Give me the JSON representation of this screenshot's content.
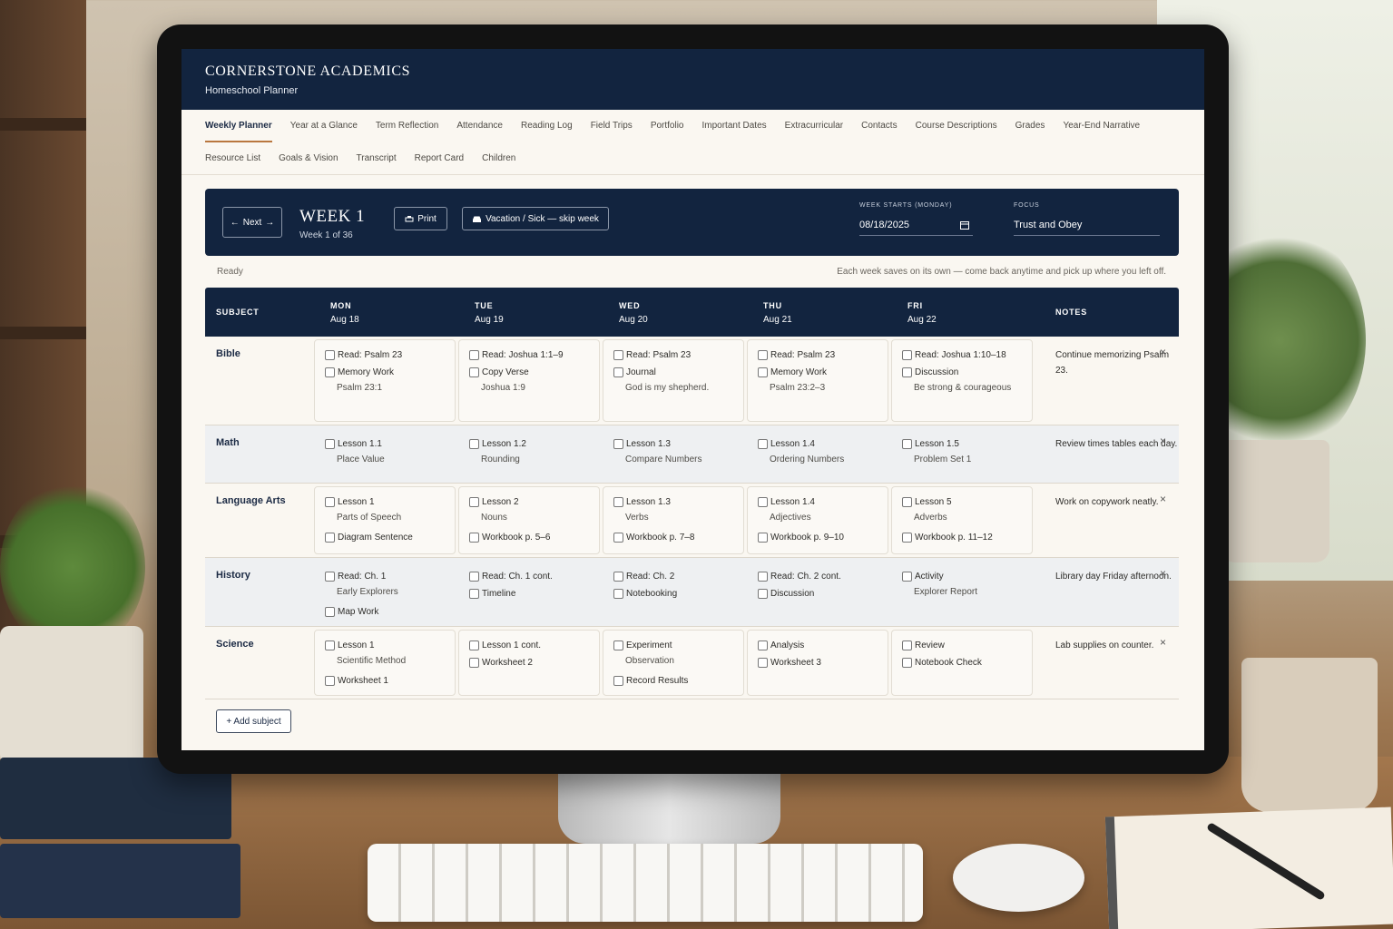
{
  "brand": {
    "title": "CORNERSTONE ACADEMICS",
    "subtitle": "Homeschool Planner"
  },
  "tabs_row1": [
    "Weekly Planner",
    "Year at a Glance",
    "Term Reflection",
    "Attendance",
    "Reading Log",
    "Field Trips",
    "Portfolio",
    "Important Dates",
    "Extracurricular",
    "Contacts",
    "Course Descriptions",
    "Grades",
    "Year-End Narrative"
  ],
  "tabs_row2": [
    "Resource List",
    "Goals & Vision",
    "Transcript",
    "Report Card",
    "Children"
  ],
  "active_tab": "Weekly Planner",
  "week": {
    "next_label": "Next",
    "title": "WEEK 1",
    "subtitle": "Week 1 of 36",
    "print_label": "Print",
    "skip_label": "Vacation / Sick — skip week",
    "start_label": "WEEK STARTS (MONDAY)",
    "start_value": "08/18/2025",
    "focus_label": "FOCUS",
    "focus_value": "Trust and Obey"
  },
  "status": {
    "left": "Ready",
    "right": "Each week saves on its own — come back anytime and pick up where you left off."
  },
  "grid": {
    "subject_header": "SUBJECT",
    "notes_header": "NOTES",
    "days": [
      {
        "day": "MON",
        "date": "Aug 18"
      },
      {
        "day": "TUE",
        "date": "Aug 19"
      },
      {
        "day": "WED",
        "date": "Aug 20"
      },
      {
        "day": "THU",
        "date": "Aug 21"
      },
      {
        "day": "FRI",
        "date": "Aug 22"
      }
    ],
    "rows": [
      {
        "subject": "Bible",
        "notes": "Continue memorizing Psalm 23.",
        "cells": [
          [
            {
              "label": "Read: Psalm 23"
            },
            {
              "label": "Memory Work",
              "sub": "Psalm 23:1"
            }
          ],
          [
            {
              "label": "Read: Joshua 1:1–9"
            },
            {
              "label": "Copy Verse",
              "sub": "Joshua 1:9"
            }
          ],
          [
            {
              "label": "Read: Psalm 23"
            },
            {
              "label": "Journal",
              "sub": "God is my shepherd."
            }
          ],
          [
            {
              "label": "Read: Psalm 23"
            },
            {
              "label": "Memory Work",
              "sub": "Psalm 23:2–3"
            }
          ],
          [
            {
              "label": "Read: Joshua 1:10–18"
            },
            {
              "label": "Discussion",
              "sub": "Be strong & courageous"
            }
          ]
        ]
      },
      {
        "subject": "Math",
        "notes": "Review times tables each day.",
        "cells": [
          [
            {
              "label": "Lesson 1.1",
              "sub": "Place Value"
            }
          ],
          [
            {
              "label": "Lesson 1.2",
              "sub": "Rounding"
            }
          ],
          [
            {
              "label": "Lesson 1.3",
              "sub": "Compare Numbers"
            }
          ],
          [
            {
              "label": "Lesson 1.4",
              "sub": "Ordering Numbers"
            }
          ],
          [
            {
              "label": "Lesson 1.5",
              "sub": "Problem Set 1"
            }
          ]
        ]
      },
      {
        "subject": "Language Arts",
        "notes": "Work on copywork neatly.",
        "cells": [
          [
            {
              "label": "Lesson 1",
              "sub": "Parts of Speech"
            },
            {
              "label": "Diagram Sentence"
            }
          ],
          [
            {
              "label": "Lesson 2",
              "sub": "Nouns"
            },
            {
              "label": "Workbook p. 5–6"
            }
          ],
          [
            {
              "label": "Lesson 1.3",
              "sub": "Verbs"
            },
            {
              "label": "Workbook p. 7–8"
            }
          ],
          [
            {
              "label": "Lesson 1.4",
              "sub": "Adjectives"
            },
            {
              "label": "Workbook p. 9–10"
            }
          ],
          [
            {
              "label": "Lesson 5",
              "sub": "Adverbs"
            },
            {
              "label": "Workbook p. 11–12"
            }
          ]
        ]
      },
      {
        "subject": "History",
        "notes": "Library day Friday afternoon.",
        "cells": [
          [
            {
              "label": "Read: Ch. 1",
              "sub": "Early Explorers"
            },
            {
              "label": "Map Work"
            }
          ],
          [
            {
              "label": "Read: Ch. 1 cont."
            },
            {
              "label": "Timeline"
            }
          ],
          [
            {
              "label": "Read: Ch. 2"
            },
            {
              "label": "Notebooking"
            }
          ],
          [
            {
              "label": "Read: Ch. 2 cont."
            },
            {
              "label": "Discussion"
            }
          ],
          [
            {
              "label": "Activity",
              "sub": "Explorer Report"
            }
          ]
        ]
      },
      {
        "subject": "Science",
        "notes": "Lab supplies on counter.",
        "cells": [
          [
            {
              "label": "Lesson 1",
              "sub": "Scientific Method"
            },
            {
              "label": "Worksheet 1"
            }
          ],
          [
            {
              "label": "Lesson 1 cont."
            },
            {
              "label": "Worksheet 2"
            }
          ],
          [
            {
              "label": "Experiment",
              "sub": "Observation"
            },
            {
              "label": "Record Results"
            }
          ],
          [
            {
              "label": "Analysis"
            },
            {
              "label": "Worksheet 3"
            }
          ],
          [
            {
              "label": "Review"
            },
            {
              "label": "Notebook Check"
            }
          ]
        ]
      }
    ]
  },
  "add_subject_label": "+ Add subject",
  "close_glyph": "×",
  "icons": {
    "prev_next": "arrow-icons",
    "print": "print-icon",
    "skip": "car-icon",
    "calendar": "calendar-icon"
  },
  "colors": {
    "navy": "#12243f",
    "accent": "#b9773f",
    "paper": "#faf7f1"
  }
}
